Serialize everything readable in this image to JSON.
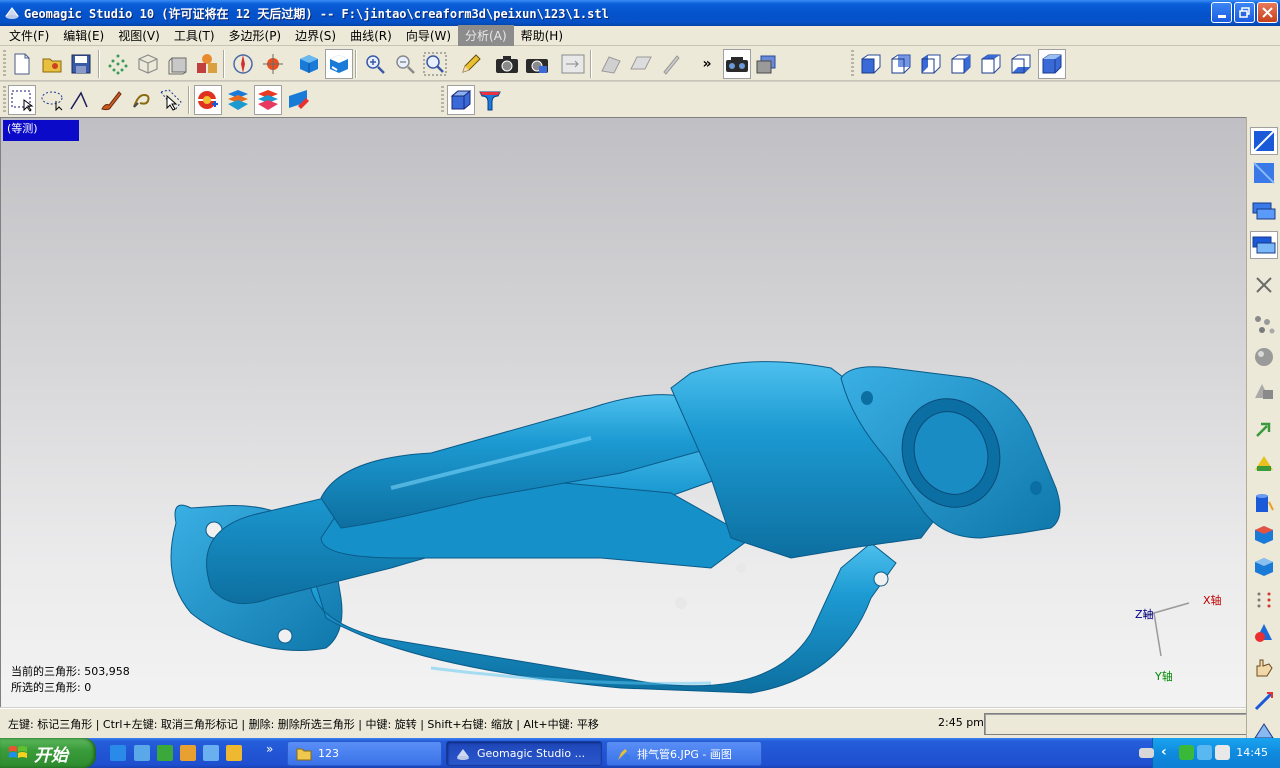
{
  "window": {
    "title": "Geomagic Studio 10 (许可证将在 12 天后过期) -- F:\\jintao\\creaform3d\\peixun\\123\\1.stl",
    "controls": [
      "minimize-icon",
      "restore-icon",
      "close-icon"
    ]
  },
  "menu": {
    "items": [
      {
        "label": "文件(F)"
      },
      {
        "label": "编辑(E)"
      },
      {
        "label": "视图(V)"
      },
      {
        "label": "工具(T)"
      },
      {
        "label": "多边形(P)"
      },
      {
        "label": "边界(S)"
      },
      {
        "label": "曲线(R)"
      },
      {
        "label": "向导(W)"
      },
      {
        "label": "分析(A)",
        "active": true
      },
      {
        "label": "帮助(H)"
      }
    ]
  },
  "toolbar1": {
    "icons": [
      "new-file-icon",
      "open-file-icon",
      "save-icon",
      "points-icon",
      "wireframe-cube-icon",
      "cube-icon",
      "objects-icon",
      "compass-icon",
      "target-icon",
      "view-cube-icon",
      "view-cube-selected-icon",
      "zoom-in-icon",
      "zoom-out-icon",
      "zoom-fit-icon",
      "pencil-icon",
      "camera-icon",
      "camera-save-icon",
      "panel-icon",
      "shape-disabled-icon",
      "plane-disabled-icon",
      "brush-disabled-icon",
      "overflow-chevron-icon",
      "camera-pair-icon",
      "copy-window-icon"
    ],
    "view_buttons": [
      "view-front-icon",
      "view-back-icon",
      "view-left-icon",
      "view-right-icon",
      "view-top-icon",
      "view-bottom-icon",
      "view-iso-icon"
    ],
    "overflow_label": "»"
  },
  "toolbar2": {
    "icons": [
      "rect-select-icon",
      "lasso-select-icon",
      "line-select-icon",
      "brush-select-icon",
      "custom-select-icon",
      "pointer-select-icon",
      "globe-icon",
      "layers-icon",
      "layers-selected-icon",
      "eraser-icon",
      "box-icon",
      "curve-icon"
    ]
  },
  "viewport": {
    "view_label": "(等测)",
    "model_color": "#1a9ad0",
    "stats": {
      "triangles_label": "当前的三角形: 503,958",
      "selected_label": "所选的三角形: 0"
    },
    "axes": {
      "x": "X轴",
      "y": "Y轴",
      "z": "Z轴"
    }
  },
  "right_toolbar": {
    "icons": [
      "plane-icon",
      "plane-shaded-icon",
      "window-stack-icon",
      "window-stack-selected-icon",
      "close-x-icon",
      "molecules-icon",
      "sphere-icon",
      "shapes-icon",
      "arrow-right-icon",
      "triangle-shape-icon",
      "cylinder-icon",
      "cube-blue-icon",
      "cube-blue-alt-icon",
      "dots-icon",
      "cone-icon",
      "hand-icon",
      "measure-icon",
      "triangle-measure-icon"
    ]
  },
  "statusbar": {
    "hint": "左键: 标记三角形 | Ctrl+左键: 取消三角形标记 | 删除: 删除所选三角形 | 中键: 旋转 | Shift+右键: 缩放 | Alt+中键: 平移",
    "time": "2:45 pm"
  },
  "taskbar": {
    "start_label": "开始",
    "quick_launch_chevron": "»",
    "tasks": [
      {
        "label": "123",
        "icon": "folder-icon",
        "active": false
      },
      {
        "label": "Geomagic Studio ...",
        "icon": "geomagic-icon",
        "active": true
      },
      {
        "label": "排气管6.JPG - 画图",
        "icon": "paint-icon",
        "active": false
      }
    ],
    "tray_chevron": "‹",
    "clock": "14:45"
  }
}
